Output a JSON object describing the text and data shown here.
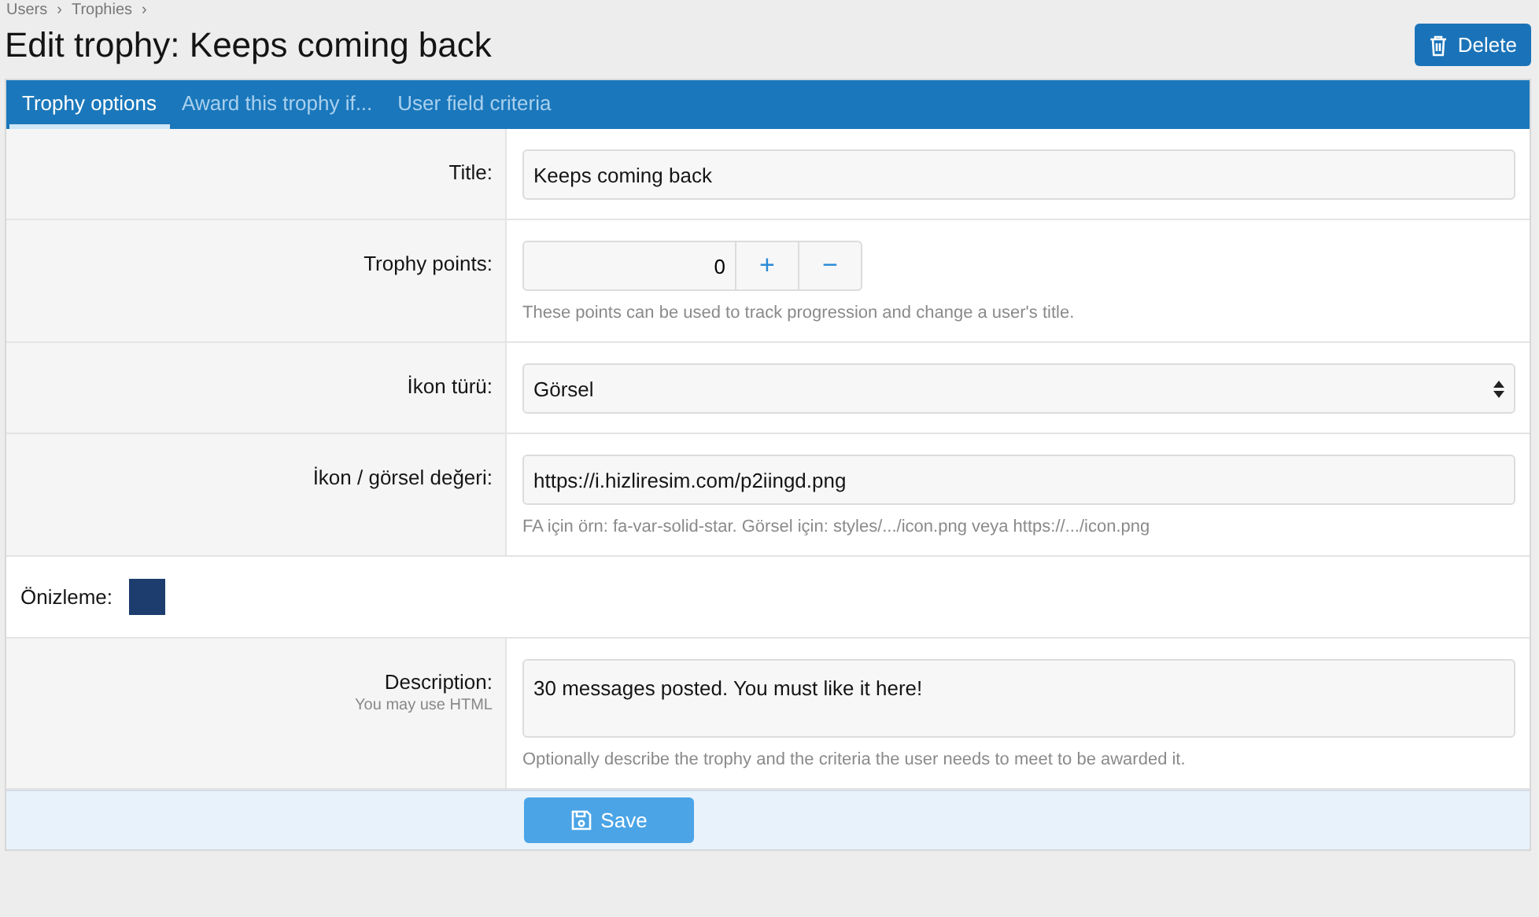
{
  "breadcrumb": {
    "separator": "›",
    "items": [
      {
        "label": "Users"
      },
      {
        "label": "Trophies"
      }
    ]
  },
  "page_title": "Edit trophy: Keeps coming back",
  "delete_button": {
    "label": "Delete"
  },
  "tabs": [
    {
      "label": "Trophy options",
      "selected": true
    },
    {
      "label": "Award this trophy if...",
      "selected": false
    },
    {
      "label": "User field criteria",
      "selected": false
    }
  ],
  "rows": [
    {
      "kind": "text",
      "label": "Title:",
      "value": "Keeps coming back"
    },
    {
      "kind": "number",
      "label": "Trophy points:",
      "value": "0",
      "increment": "+",
      "decrement": "−",
      "hint": "These points can be used to track progression and change a user's title."
    },
    {
      "kind": "select",
      "label": "İkon türü:",
      "value": "Görsel"
    },
    {
      "kind": "text",
      "label": "İkon / görsel değeri:",
      "value": "https://i.hizliresim.com/p2iingd.png",
      "hint": "FA için örn: fa-var-solid-star. Görsel için: styles/.../icon.png veya https://.../icon.png"
    },
    {
      "kind": "preview",
      "label": "Önizleme:"
    },
    {
      "kind": "textarea",
      "label": "Description:",
      "sublabel": "You may use HTML",
      "value": "30 messages posted. You must like it here!",
      "hint": "Optionally describe the trophy and the criteria the user needs to meet to be awarded it."
    }
  ],
  "save_button": {
    "label": "Save"
  }
}
